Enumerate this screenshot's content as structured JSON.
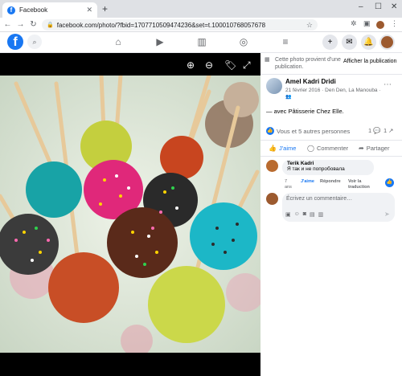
{
  "browser": {
    "tab_title": "Facebook",
    "url": "facebook.com/photo/?fbid=1707710509474236&set=t.100010768057678",
    "new_tab": "+",
    "window_controls": [
      "–",
      "☐",
      "✕"
    ]
  },
  "fb_header": {
    "logo": "f",
    "nav_icons": [
      "home-icon",
      "watch-icon",
      "marketplace-icon",
      "groups-icon",
      "menu-icon"
    ]
  },
  "photo_toolbar": [
    "zoom-in-icon",
    "zoom-out-icon",
    "tag-icon",
    "fullscreen-icon"
  ],
  "panel": {
    "notice": "Cette photo provient d'une publication.",
    "show_post": "Afficher la publication",
    "author": "Amel Kadri Dridi",
    "date_place": "21 février 2016 · Den Den, La Manouba ·",
    "caption": "— avec Pâtisserie Chez Elle.",
    "reactions_text": "Vous et 5 autres personnes",
    "comment_count": "1",
    "share_count": "1",
    "actions": {
      "like": "J'aime",
      "comment": "Commenter",
      "share": "Partager"
    },
    "comment": {
      "author": "Terik Kadri",
      "text": "Я так и не попробовала",
      "age": "7 ans",
      "like": "J'aime",
      "reply": "Répondre",
      "translate": "Voir la traduction"
    },
    "comment_placeholder": "Écrivez un commentaire…"
  },
  "colors": {
    "fb_blue": "#1877f2",
    "text_secondary": "#65676b",
    "photo_bg": "#000000"
  }
}
